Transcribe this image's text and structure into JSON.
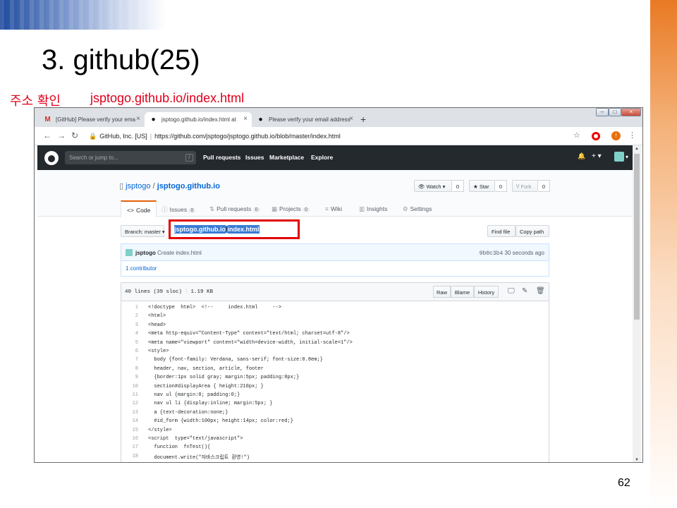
{
  "slide": {
    "title": "3. github(25)",
    "subtitle_label": "주소 확인",
    "subtitle_url": "jsptogo.github.io/index.html",
    "page_number": "62"
  },
  "browser": {
    "tabs": [
      {
        "label": "[GitHub] Please verify your ema",
        "favicon": "gmail-icon",
        "active": false
      },
      {
        "label": "jsptogo.github.io/index.html at",
        "favicon": "github-icon",
        "active": true
      },
      {
        "label": "Please verify your email address",
        "favicon": "github-icon",
        "active": false
      }
    ],
    "new_tab": "+",
    "close_glyph": "×",
    "address": {
      "security_label": "GitHub, Inc. [US]",
      "separator": "|",
      "url": "https://github.com/jsptogo/jsptogo.github.io/blob/master/index.html"
    },
    "user_badge": "!"
  },
  "github": {
    "search_placeholder": "Search or jump to...",
    "search_shortcut": "/",
    "nav": [
      "Pull requests",
      "Issues",
      "Marketplace",
      "Explore"
    ],
    "header_right": {
      "bell": "🔔",
      "plus": "+ ▾",
      "avatar_caret": "▾"
    },
    "repo": {
      "owner": "jsptogo",
      "separator": "/",
      "name": "jsptogo.github.io",
      "watch_label": "Watch ▾",
      "watch_count": "0",
      "star_label": "Star",
      "star_count": "0",
      "fork_label": "Fork",
      "fork_count": "0"
    },
    "tabs": [
      {
        "label": "Code",
        "icon": "<>",
        "count": ""
      },
      {
        "label": "Issues",
        "icon": "ⓘ",
        "count": "0"
      },
      {
        "label": "Pull requests",
        "icon": "⇅",
        "count": "0"
      },
      {
        "label": "Projects",
        "icon": "▦",
        "count": "0"
      },
      {
        "label": "Wiki",
        "icon": "≡",
        "count": ""
      },
      {
        "label": "Insights",
        "icon": "▥",
        "count": ""
      },
      {
        "label": "Settings",
        "icon": "⚙",
        "count": ""
      }
    ],
    "branch_label": "Branch: master ▾",
    "path": {
      "repo": "jsptogo.github.io",
      "sep": "/",
      "file": "index.html"
    },
    "find_file": "Find file",
    "copy_path": "Copy path",
    "commit": {
      "author": "jsptogo",
      "message": "Create index.html",
      "sha": "9b0c3b4",
      "time": "30 seconds ago"
    },
    "contributors": "1 contributor",
    "file": {
      "lines_info": "40 lines (39 sloc)",
      "divider": "|",
      "size": "1.19 KB",
      "raw": "Raw",
      "blame": "Blame",
      "history": "History"
    },
    "code_lines": [
      {
        "n": "1",
        "t": "<!doctype  html>  <!--     index.html     -->"
      },
      {
        "n": "2",
        "t": "<html>"
      },
      {
        "n": "3",
        "t": "<head>"
      },
      {
        "n": "4",
        "t": "<meta http-equiv=\"Content-Type\" content=\"text/html; charset=utf-8\"/>"
      },
      {
        "n": "5",
        "t": "<meta name=\"viewport\" content=\"width=device-width, initial-scale=1\"/>"
      },
      {
        "n": "6",
        "t": "<style>"
      },
      {
        "n": "7",
        "t": "  body {font-family: Verdana, sans-serif; font-size:0.8em;}"
      },
      {
        "n": "8",
        "t": "  header, nav, section, article, footer"
      },
      {
        "n": "9",
        "t": "  {border:1px solid gray; margin:5px; padding:8px;}"
      },
      {
        "n": "10",
        "t": "  section#displayArea { height:210px; }"
      },
      {
        "n": "11",
        "t": "  nav ul {margin:0; padding:0;}"
      },
      {
        "n": "12",
        "t": "  nav ul li {display:inline; margin:5px; }"
      },
      {
        "n": "13",
        "t": "  a {text-decoration:none;}"
      },
      {
        "n": "14",
        "t": "  #id_form {width:100px; height:14px; color:red;}"
      },
      {
        "n": "15",
        "t": "</style>"
      },
      {
        "n": "16",
        "t": "<script  type=\"text/javascript\">"
      },
      {
        "n": "17",
        "t": "  function  fnTest(){"
      },
      {
        "n": "18",
        "t": "  document.write(\"자바스크립트 환영!\")"
      }
    ]
  }
}
